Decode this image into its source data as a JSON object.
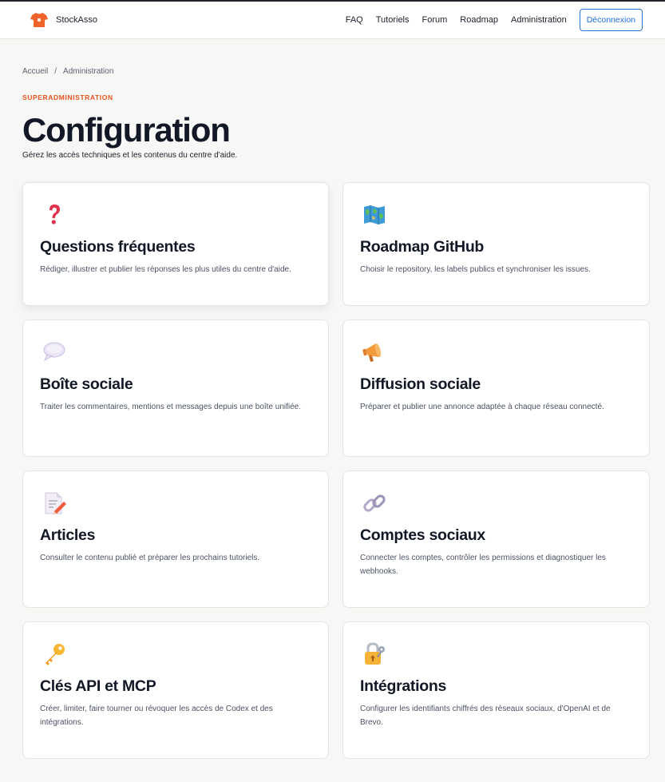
{
  "brand": {
    "name": "StockAsso",
    "logo_icon": "t-shirt-icon"
  },
  "nav": {
    "items": [
      "FAQ",
      "Tutoriels",
      "Forum",
      "Roadmap",
      "Administration"
    ],
    "logout_label": "Déconnexion"
  },
  "breadcrumb": {
    "home": "Accueil",
    "separator": "/",
    "current": "Administration"
  },
  "page": {
    "eyebrow": "SUPERADMINISTRATION",
    "title": "Configuration",
    "subtitle": "Gérez les accès techniques et les contenus du centre d'aide."
  },
  "cards": [
    {
      "icon": "question-mark-icon",
      "title": "Questions fréquentes",
      "description": "Rédiger, illustrer et publier les réponses les plus utiles du centre d'aide."
    },
    {
      "icon": "map-icon",
      "title": "Roadmap GitHub",
      "description": "Choisir le repository, les labels publics et synchroniser les issues."
    },
    {
      "icon": "speech-bubble-icon",
      "title": "Boîte sociale",
      "description": "Traiter les commentaires, mentions et messages depuis une boîte unifiée."
    },
    {
      "icon": "megaphone-icon",
      "title": "Diffusion sociale",
      "description": "Préparer et publier une annonce adaptée à chaque réseau connecté."
    },
    {
      "icon": "memo-icon",
      "title": "Articles",
      "description": "Consulter le contenu publié et préparer les prochains tutoriels."
    },
    {
      "icon": "link-icon",
      "title": "Comptes sociaux",
      "description": "Connecter les comptes, contrôler les permissions et diagnostiquer les webhooks."
    },
    {
      "icon": "key-icon",
      "title": "Clés API et MCP",
      "description": "Créer, limiter, faire tourner ou révoquer les accès de Codex et des intégrations."
    },
    {
      "icon": "lock-with-key-icon",
      "title": "Intégrations",
      "description": "Configurer les identifiants chiffrés des réseaux sociaux, d'OpenAI et de Brevo."
    }
  ],
  "colors": {
    "accent": "#e5531f",
    "link": "#1d6fd6",
    "background": "#f7f7f5",
    "text": "#121826"
  }
}
